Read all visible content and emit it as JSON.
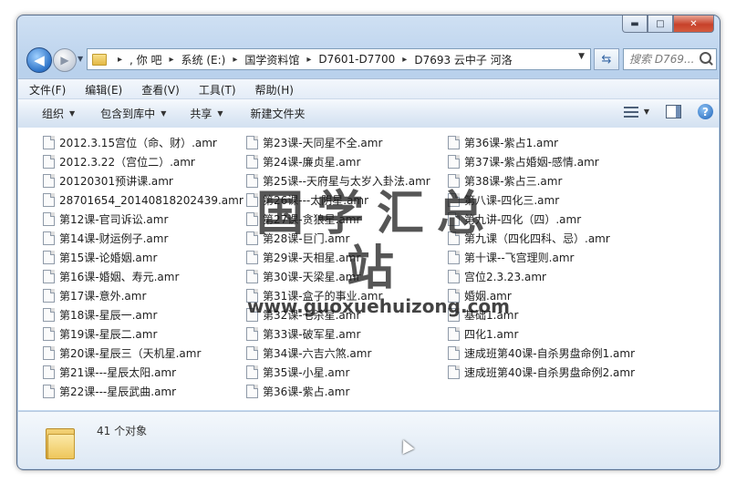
{
  "window": {
    "caption_buttons": {
      "minimize": "▬",
      "maximize": "□",
      "close": "✕"
    }
  },
  "nav": {
    "back_glyph": "◀",
    "forward_glyph": "▶",
    "history_glyph": "▼",
    "breadcrumb": [
      ", 你  吧",
      "系统 (E:)",
      "国学资料馆",
      "D7601-D7700",
      "D7693 云中子 河洛"
    ],
    "breadcrumb_sep": "▸",
    "address_dropdown_glyph": "▼",
    "refresh_glyph": "⇆",
    "search_placeholder": "搜索 D769..."
  },
  "menu": {
    "items": [
      "文件(F)",
      "编辑(E)",
      "查看(V)",
      "工具(T)",
      "帮助(H)"
    ]
  },
  "toolbar": {
    "organize": "组织",
    "include_library": "包含到库中",
    "share": "共享",
    "new_folder": "新建文件夹",
    "dropdown_glyph": "▼",
    "help_glyph": "?"
  },
  "files": {
    "col1": [
      "2012.3.15宫位（命、财）.amr",
      "2012.3.22（宫位二）.amr",
      "20120301预讲课.amr",
      "28701654_20140818202439.amr",
      "第12课-官司诉讼.amr",
      "第14课-财运例子.amr",
      "第15课-论婚姻.amr",
      "第16课-婚姻、寿元.amr",
      "第17课-意外.amr",
      "第18课-星辰一.amr",
      "第19课-星辰二.amr",
      "第20课-星辰三（天机星.amr",
      "第21课---星辰太阳.amr",
      "第22课---星辰武曲.amr"
    ],
    "col2": [
      "第23课-天同星不全.amr",
      "第24课-廉贞星.amr",
      "第25课--天府星与太岁入卦法.amr",
      "第26课---太阴星.amr",
      "第27课-贪狼星.amr",
      "第28课-巨门.amr",
      "第29课-天相星.amr",
      "第30课-天梁星.amr",
      "第31课-盒子的事业.amr",
      "第32课-七杀星.amr",
      "第33课-破军星.amr",
      "第34课-六吉六煞.amr",
      "第35课-小星.amr",
      "第36课-紫占.amr"
    ],
    "col3": [
      "第36课-紫占1.amr",
      "第37课-紫占婚姻-感情.amr",
      "第38课-紫占三.amr",
      "第八课-四化三.amr",
      "第九讲-四化（四）.amr",
      "第九课（四化四科、忌）.amr",
      "第十课--飞宫理则.amr",
      "宫位2.3.23.amr",
      "婚姻.amr",
      "基础1.amr",
      "四化1.amr",
      "速成班第40课-自杀男盘命例1.amr",
      "速成班第40课-自杀男盘命例2.amr"
    ]
  },
  "watermark": {
    "title": "国学汇总站",
    "url": "www.guoxuehuizong.com"
  },
  "status": {
    "count": "41 个对象"
  }
}
